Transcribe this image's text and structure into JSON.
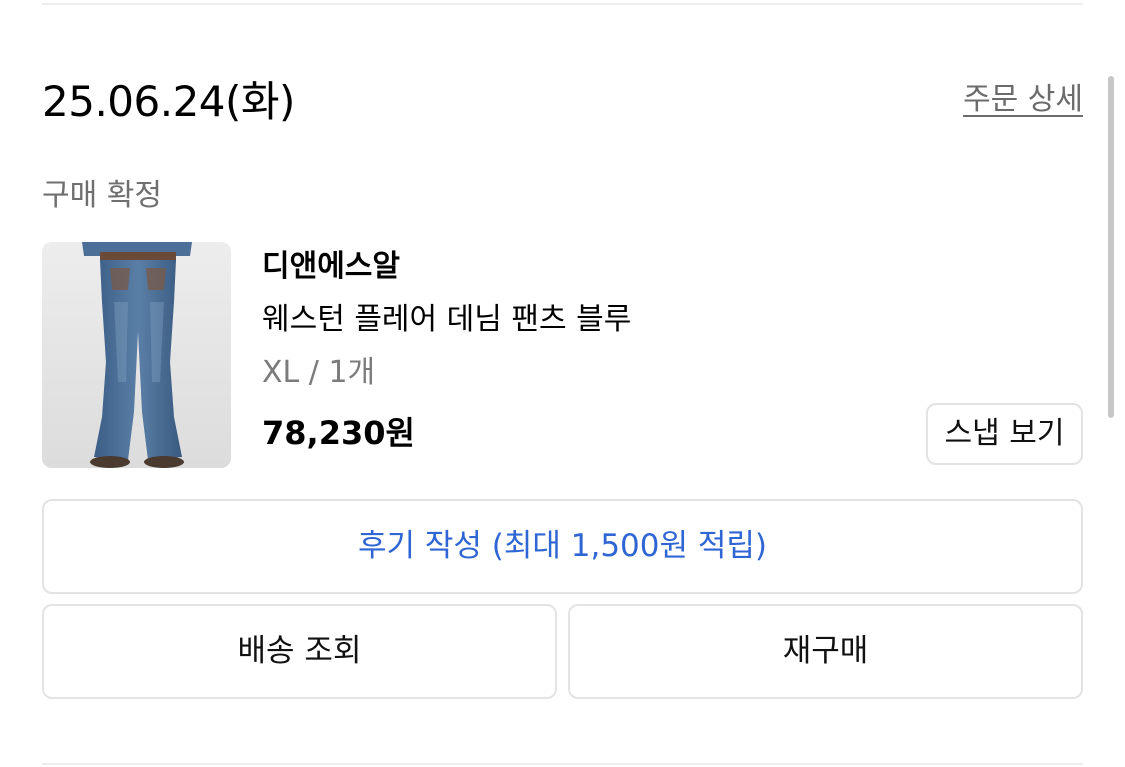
{
  "order": {
    "date": "25.06.24(화)",
    "detail_link": "주문 상세",
    "status": "구매 확정"
  },
  "product": {
    "image_icon": "denim-pants-photo",
    "brand": "디앤에스알",
    "name": "웨스턴 플레어 데님 팬츠 블루",
    "option": "XL / 1개",
    "price": "78,230원",
    "snap_button": "스냅 보기"
  },
  "actions": {
    "review": "후기 작성 (최대 1,500원 적립)",
    "shipping": "배송 조회",
    "rebuy": "재구매"
  },
  "colors": {
    "accent": "#2f66d4",
    "border": "#e3e3e3",
    "secondary_text": "#6f6f6f"
  }
}
